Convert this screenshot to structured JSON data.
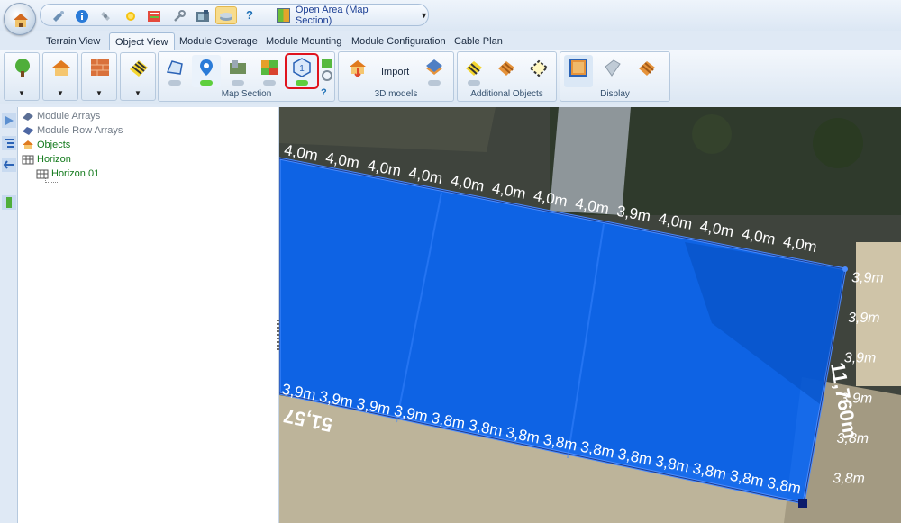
{
  "quick_access": {
    "icons": [
      "app-orb-icon",
      "tools-icon",
      "info-icon",
      "satellite-icon",
      "sun-icon",
      "chart-icon",
      "wrench-icon",
      "map-photo-icon",
      "layers-icon",
      "help-icon"
    ],
    "help_label": "?",
    "open_area_label": "Open Area (Map Section)"
  },
  "tabs": [
    {
      "label": "Terrain View",
      "active": false
    },
    {
      "label": "Object View",
      "active": true
    },
    {
      "label": "Module Coverage",
      "active": false
    },
    {
      "label": "Module Mounting",
      "active": false
    },
    {
      "label": "Module Configuration",
      "active": false
    },
    {
      "label": "Cable Plan",
      "active": false
    }
  ],
  "ribbon": {
    "groups": {
      "map_section": "Map Section",
      "models_3d": "3D models",
      "additional_objects": "Additional Objects",
      "display": "Display"
    },
    "import_label": "Import",
    "help_label": "?"
  },
  "tree": {
    "items": [
      {
        "label": "Module Arrays",
        "style": "grey"
      },
      {
        "label": "Module Row Arrays",
        "style": "grey"
      },
      {
        "label": "Objects",
        "style": "green"
      },
      {
        "label": "Horizon",
        "style": "green"
      },
      {
        "label": "Horizon 01",
        "style": "green"
      }
    ]
  },
  "map": {
    "top_edge_labels": [
      "4,0m",
      "4,0m",
      "4,0m",
      "4,0m",
      "4,0m",
      "4,0m",
      "4,0m",
      "4,0m",
      "3,9m",
      "4,0m",
      "4,0m",
      "4,0m",
      "4,0m"
    ],
    "bottom_edge_labels": [
      "3,9m",
      "3,9m",
      "3,9m",
      "3,9m",
      "3,8m",
      "3,8m",
      "3,8m",
      "3,8m",
      "3,8m",
      "3,8m",
      "3,8m",
      "3,8m",
      "3,8m",
      "3,8m"
    ],
    "right_edge_labels": [
      "3,9m",
      "3,9m",
      "3,9m",
      "3,9m",
      "3,8m",
      "3,8m"
    ],
    "side_length_label": "11,760m",
    "bottom_length_label": "51,57",
    "colors": {
      "polygon_fill": "#0a66f2",
      "polygon_stroke": "#4b8cff",
      "label": "#ffffff"
    }
  }
}
